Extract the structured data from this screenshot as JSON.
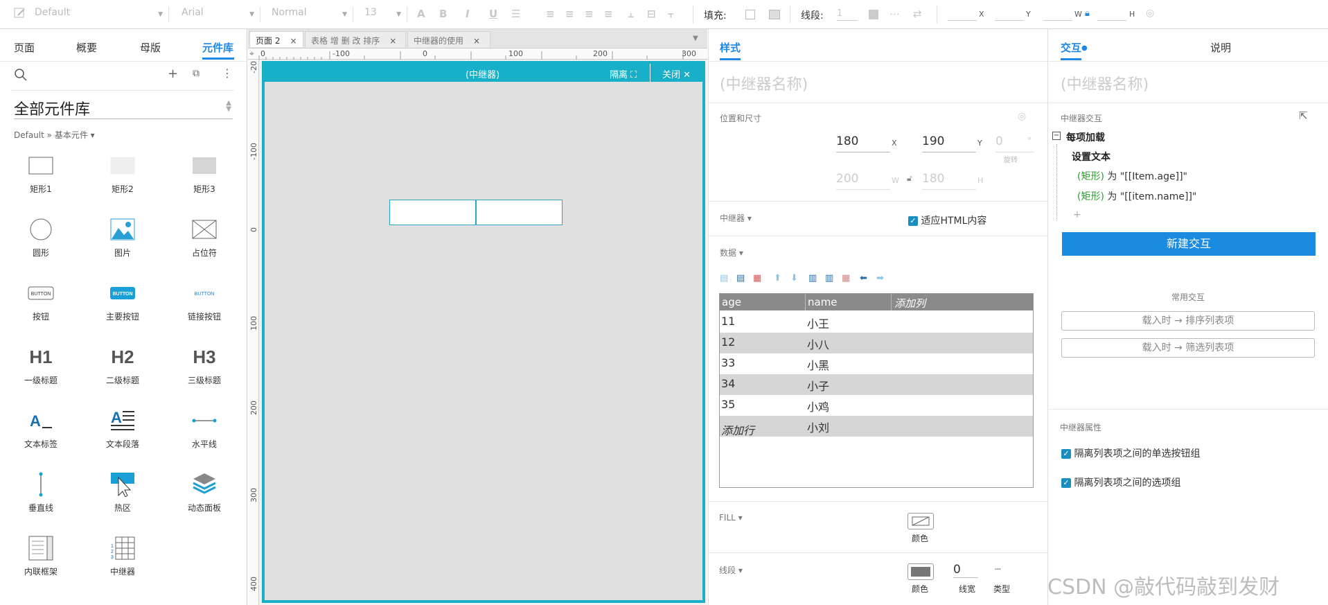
{
  "toolbar": {
    "style_select": "Default",
    "font_select": "Arial",
    "weight_select": "Normal",
    "size_select": "13",
    "fill_label": "填充:",
    "stroke_label": "线段:",
    "stroke_value": "1",
    "axis_x": "X",
    "axis_y": "Y",
    "axis_w": "W",
    "axis_h": "H"
  },
  "left": {
    "tabs": [
      "页面",
      "概要",
      "母版",
      "元件库"
    ],
    "active_tab": "元件库",
    "library_title": "全部元件库",
    "breadcrumb": "Default » 基本元件 ▾",
    "items": [
      {
        "label": "矩形1",
        "icon": "rect-outline-icon"
      },
      {
        "label": "矩形2",
        "icon": "rect-light-icon"
      },
      {
        "label": "矩形3",
        "icon": "rect-gray-icon"
      },
      {
        "label": "圆形",
        "icon": "circle-icon"
      },
      {
        "label": "图片",
        "icon": "image-icon"
      },
      {
        "label": "占位符",
        "icon": "placeholder-icon"
      },
      {
        "label": "按钮",
        "icon": "button-icon",
        "text": "BUTTON"
      },
      {
        "label": "主要按钮",
        "icon": "primary-button-icon",
        "text": "BUTTON"
      },
      {
        "label": "链接按钮",
        "icon": "link-button-icon",
        "text": "BUTTON"
      },
      {
        "label": "一级标题",
        "icon": "h1-icon",
        "text": "H1"
      },
      {
        "label": "二级标题",
        "icon": "h2-icon",
        "text": "H2"
      },
      {
        "label": "三级标题",
        "icon": "h3-icon",
        "text": "H3"
      },
      {
        "label": "文本标签",
        "icon": "text-label-icon"
      },
      {
        "label": "文本段落",
        "icon": "text-paragraph-icon"
      },
      {
        "label": "水平线",
        "icon": "horizontal-line-icon"
      },
      {
        "label": "垂直线",
        "icon": "vertical-line-icon"
      },
      {
        "label": "热区",
        "icon": "hotspot-icon"
      },
      {
        "label": "动态面板",
        "icon": "dynamic-panel-icon"
      },
      {
        "label": "内联框架",
        "icon": "inline-frame-icon"
      },
      {
        "label": "中继器",
        "icon": "repeater-icon"
      }
    ]
  },
  "center": {
    "tabs": [
      {
        "label": "页面 2",
        "active": true
      },
      {
        "label": "表格 增 删 改 排序",
        "active": false
      },
      {
        "label": "中继器的使用",
        "active": false
      }
    ],
    "ruler_h": [
      "0",
      "-100",
      "0",
      "100",
      "200",
      "300"
    ],
    "ruler_v": [
      "-20",
      "-100",
      "0",
      "100",
      "200",
      "300",
      "400"
    ],
    "editor_title": "(中继器)",
    "isolate_label": "隔离",
    "close_label": "关闭"
  },
  "styles": {
    "tab": "样式",
    "name_placeholder": "(中继器名称)",
    "pos_size_label": "位置和尺寸",
    "x_value": "180",
    "y_value": "190",
    "rotate_value": "0",
    "rotate_unit": "°",
    "rotate_label": "旋转",
    "w_value": "200",
    "h_value": "180",
    "repeater_label": "中继器 ▾",
    "fit_html_label": "适应HTML内容",
    "data_label": "数据 ▾",
    "table": {
      "headers": [
        "age",
        "name",
        "添加列"
      ],
      "rows": [
        [
          "11",
          "小王"
        ],
        [
          "12",
          "小八"
        ],
        [
          "33",
          "小黑"
        ],
        [
          "34",
          "小子"
        ],
        [
          "35",
          "小鸡"
        ],
        [
          "",
          "小刘"
        ]
      ],
      "add_row": "添加行"
    },
    "fill_label": "FILL ▾",
    "color_label": "颜色",
    "stroke_label": "线段 ▾",
    "stroke_width_value": "0",
    "stroke_width_label": "线宽",
    "stroke_type_label": "类型"
  },
  "interactions": {
    "tabs": [
      "交互",
      "说明"
    ],
    "name_placeholder": "(中继器名称)",
    "section_label": "中继器交互",
    "event": "每项加载",
    "action": "设置文本",
    "lines": [
      {
        "target": "(矩形)",
        "text": "为 \"[[Item.age]]\""
      },
      {
        "target": "(矩形)",
        "text": "为 \"[[item.name]]\""
      }
    ],
    "add_symbol": "+",
    "new_interaction": "新建交互",
    "common_label": "常用交互",
    "common": [
      "载入时 → 排序列表项",
      "载入时 → 筛选列表项"
    ],
    "props_label": "中继器属性",
    "props": [
      "隔离列表项之间的单选按钮组",
      "隔离列表项之间的选项组"
    ]
  },
  "watermark": "CSDN @敲代码敲到发财"
}
